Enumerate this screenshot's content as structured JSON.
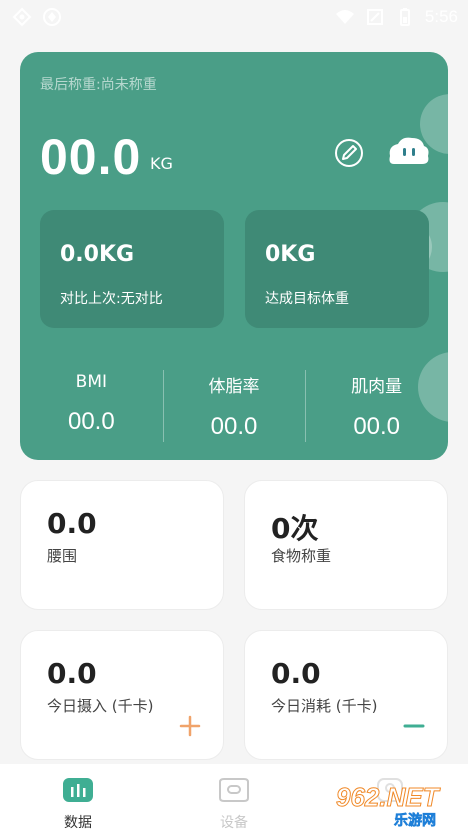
{
  "status_bar": {
    "time": "5:56"
  },
  "hero": {
    "last_weigh_label": "最后称重:尚未称重",
    "weight_value": "00.0",
    "weight_unit": "KG",
    "compare": {
      "value": "0.0KG",
      "label": "对比上次:无对比"
    },
    "target": {
      "value": "0KG",
      "label": "达成目标体重"
    },
    "metrics": [
      {
        "label": "BMI",
        "value": "00.0"
      },
      {
        "label": "体脂率",
        "value": "00.0"
      },
      {
        "label": "肌肉量",
        "value": "00.0"
      }
    ]
  },
  "cards": [
    {
      "value": "0.0",
      "label": "腰围"
    },
    {
      "value": "0次",
      "label": "食物称重"
    },
    {
      "value": "0.0",
      "label": "今日摄入 (千卡)",
      "action_icon": "plus-icon"
    },
    {
      "value": "0.0",
      "label": "今日消耗 (千卡)",
      "action_icon": "minus-icon"
    }
  ],
  "bottom_nav": [
    {
      "label": "数据",
      "icon": "chart-icon",
      "active": true
    },
    {
      "label": "设备",
      "icon": "device-icon",
      "active": false
    },
    {
      "label": "",
      "icon": "profile-icon",
      "active": false
    }
  ],
  "watermark": {
    "big": "962.NET",
    "small": "乐游网"
  },
  "colors": {
    "accent": "#4a9e87",
    "accent_dark": "#3f8a76",
    "plus": "#f0a36a",
    "minus": "#3fae93",
    "nav_active": "#3fae93"
  }
}
